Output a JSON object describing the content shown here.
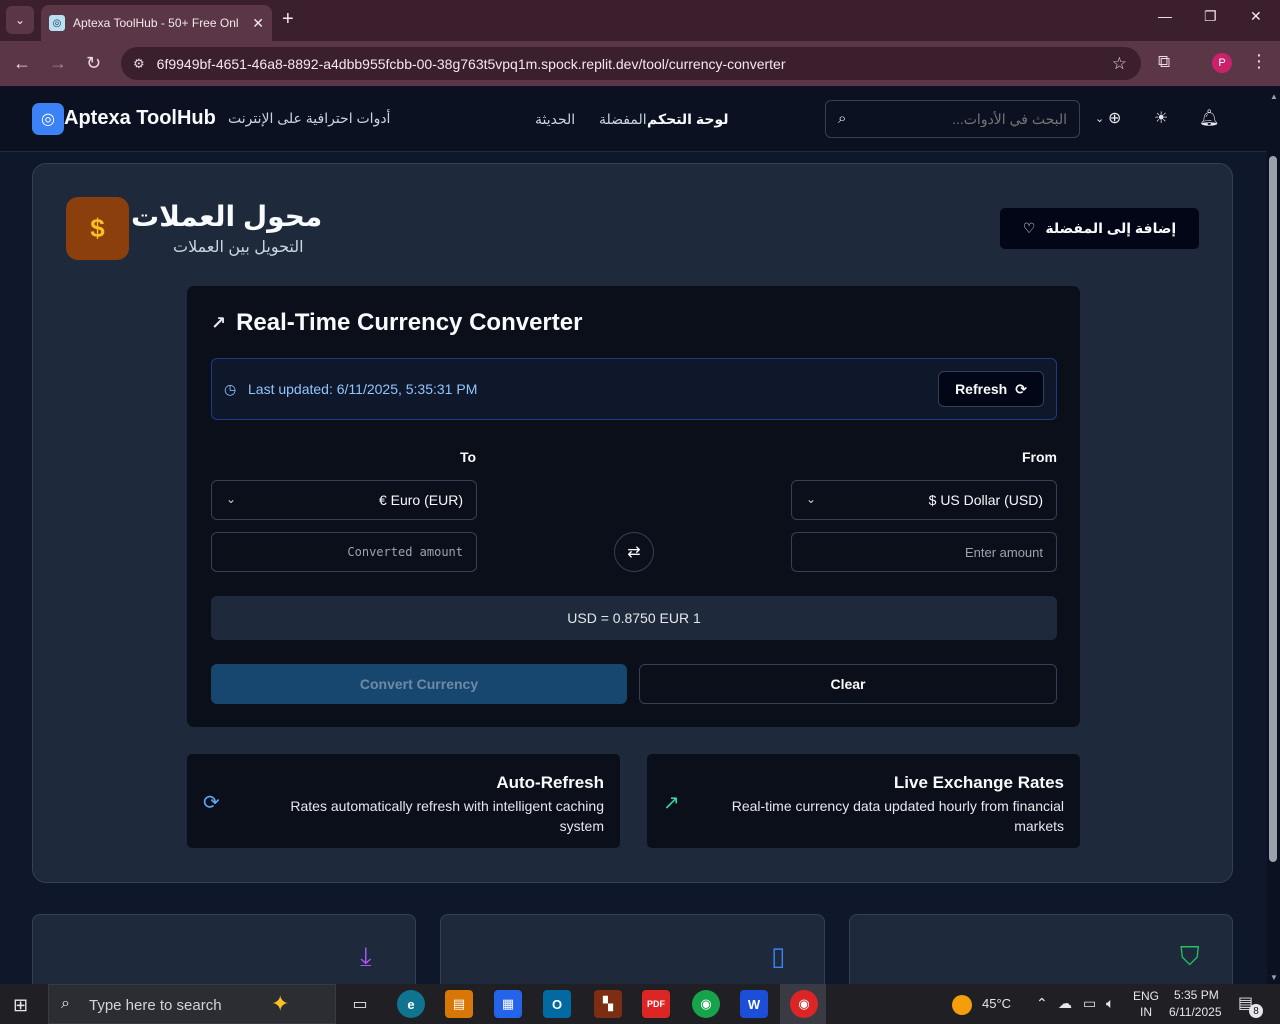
{
  "browser": {
    "tab_title": "Aptexa ToolHub - 50+ Free Onl",
    "url": "6f9949bf-4651-46a8-8892-a4dbb955fcbb-00-38g763t5vpq1m.spock.replit.dev/tool/currency-converter",
    "profile_initial": "P"
  },
  "header": {
    "brand": "Aptexa ToolHub",
    "tagline": "أدوات احترافية على الإنترنت",
    "nav": {
      "recent": "الحديثة",
      "favorites": "المفضلة",
      "dashboard": "لوحة التحكم"
    },
    "search_placeholder": "البحث في الأدوات..."
  },
  "tool": {
    "icon_glyph": "$",
    "title": "محول العملات",
    "subtitle": "التحويل بين العملات",
    "favorite_button": "إضافة إلى المفضلة"
  },
  "converter": {
    "title": "Real-Time Currency Converter",
    "last_updated": "Last updated: 6/11/2025, 5:35:31 PM",
    "refresh_label": "Refresh",
    "to_label": "To",
    "from_label": "From",
    "to_currency": "€ Euro (EUR)",
    "from_currency": "$ US Dollar (USD)",
    "to_placeholder": "Converted amount",
    "from_placeholder": "Enter amount",
    "rate_text": "USD = 0.8750 EUR 1",
    "convert_label": "Convert Currency",
    "clear_label": "Clear"
  },
  "features": [
    {
      "title": "Auto-Refresh",
      "desc_line1": "Rates automatically refresh with intelligent caching",
      "desc_line2": "system"
    },
    {
      "title": "Live Exchange Rates",
      "desc_line1": "Real-time currency data updated hourly from financial",
      "desc_line2": "markets"
    }
  ],
  "taskbar": {
    "search_placeholder": "Type here to search",
    "temperature": "45°C",
    "lang_top": "ENG",
    "lang_bottom": "IN",
    "time": "5:35 PM",
    "date": "6/11/2025",
    "notification_count": "8"
  },
  "colors": {
    "accent_blue": "#3b82f6",
    "tool_icon_bg": "#8a3f0d",
    "convert_btn": "#17476e"
  }
}
